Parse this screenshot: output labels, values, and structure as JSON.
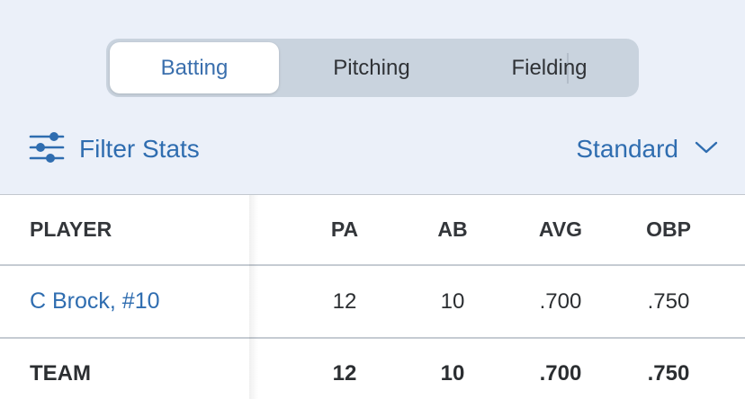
{
  "tabs": [
    {
      "label": "Batting",
      "active": true
    },
    {
      "label": "Pitching",
      "active": false
    },
    {
      "label": "Fielding",
      "active": false
    }
  ],
  "filter": {
    "label": "Filter Stats",
    "icon": "sliders-icon"
  },
  "view_select": {
    "label": "Standard",
    "icon": "chevron-down-icon"
  },
  "table": {
    "columns": [
      "PLAYER",
      "PA",
      "AB",
      "AVG",
      "OBP"
    ],
    "rows": [
      {
        "player": "C Brock, #10",
        "pa": "12",
        "ab": "10",
        "avg": ".700",
        "obp": ".750"
      }
    ],
    "total": {
      "player": "TEAM",
      "pa": "12",
      "ab": "10",
      "avg": ".700",
      "obp": ".750"
    }
  },
  "colors": {
    "accent": "#2f6db0",
    "header_bg": "#ebf0f9",
    "segment_bg": "#c9d3de"
  }
}
